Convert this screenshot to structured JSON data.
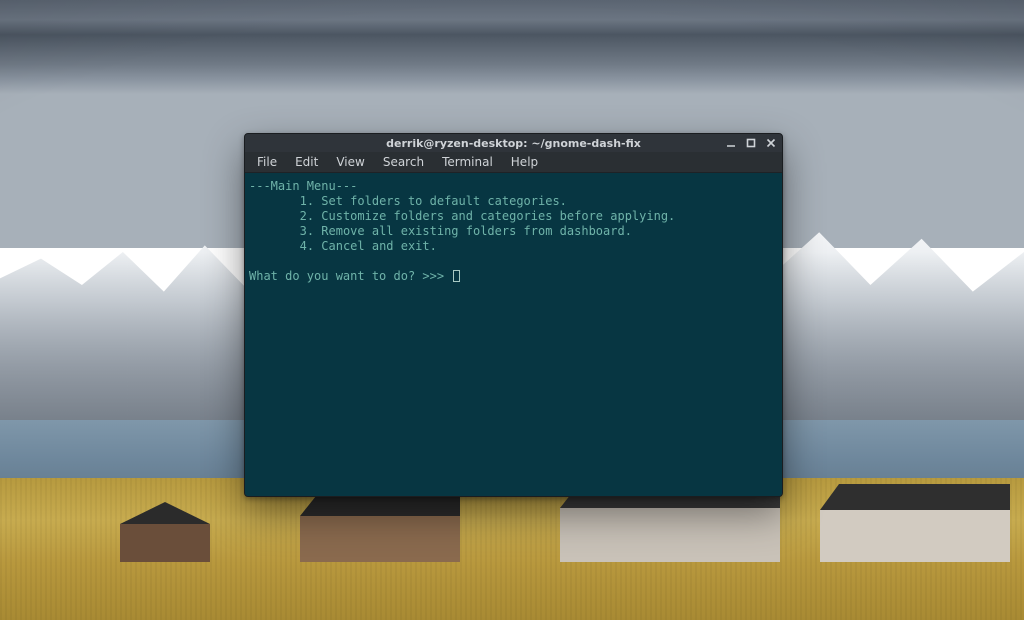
{
  "window": {
    "title": "derrik@ryzen-desktop: ~/gnome-dash-fix",
    "controls": {
      "minimize": "minimize",
      "maximize": "maximize",
      "close": "close"
    }
  },
  "menubar": {
    "items": [
      {
        "label": "File"
      },
      {
        "label": "Edit"
      },
      {
        "label": "View"
      },
      {
        "label": "Search"
      },
      {
        "label": "Terminal"
      },
      {
        "label": "Help"
      }
    ]
  },
  "terminal": {
    "header": "---Main Menu---",
    "options": [
      {
        "num": "1",
        "text": "Set folders to default categories."
      },
      {
        "num": "2",
        "text": "Customize folders and categories before applying."
      },
      {
        "num": "3",
        "text": "Remove all existing folders from dashboard."
      },
      {
        "num": "4",
        "text": "Cancel and exit."
      }
    ],
    "prompt": "What do you want to do? >>> "
  }
}
